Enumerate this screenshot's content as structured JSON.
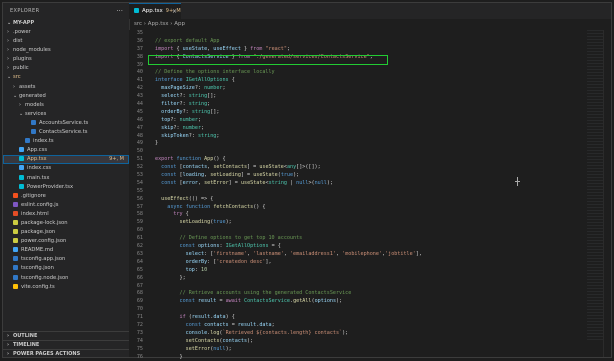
{
  "explorer": {
    "title": "EXPLORER",
    "menu": "···",
    "root": "MY-APP",
    "items": [
      {
        "label": ".power",
        "depth": 0,
        "chev": "›",
        "color": ""
      },
      {
        "label": "dist",
        "depth": 0,
        "chev": "›",
        "color": ""
      },
      {
        "label": "node_modules",
        "depth": 0,
        "chev": "›",
        "color": ""
      },
      {
        "label": "plugins",
        "depth": 0,
        "chev": "›",
        "color": ""
      },
      {
        "label": "public",
        "depth": 0,
        "chev": "›",
        "color": ""
      },
      {
        "label": "src",
        "depth": 0,
        "chev": "⌄",
        "color": "#e2c08d"
      },
      {
        "label": "assets",
        "depth": 1,
        "chev": "›",
        "color": ""
      },
      {
        "label": "generated",
        "depth": 1,
        "chev": "⌄",
        "color": ""
      },
      {
        "label": "models",
        "depth": 2,
        "chev": "›",
        "color": ""
      },
      {
        "label": "services",
        "depth": 2,
        "chev": "⌄",
        "color": ""
      },
      {
        "label": "AccountsService.ts",
        "depth": 3,
        "chev": "",
        "icon": "#3178c6",
        "color": ""
      },
      {
        "label": "ContactsService.ts",
        "depth": 3,
        "chev": "",
        "icon": "#3178c6",
        "color": ""
      },
      {
        "label": "index.ts",
        "depth": 2,
        "chev": "",
        "icon": "#3178c6",
        "color": ""
      },
      {
        "label": "App.css",
        "depth": 1,
        "chev": "",
        "icon": "#42a5f5",
        "color": ""
      },
      {
        "label": "App.tsx",
        "depth": 1,
        "chev": "",
        "icon": "#00bcd4",
        "color": "#e2c08d",
        "active": true,
        "badge": "9+, M"
      },
      {
        "label": "index.css",
        "depth": 1,
        "chev": "",
        "icon": "#42a5f5",
        "color": ""
      },
      {
        "label": "main.tsx",
        "depth": 1,
        "chev": "",
        "icon": "#00bcd4",
        "color": ""
      },
      {
        "label": "PowerProvider.tsx",
        "depth": 1,
        "chev": "",
        "icon": "#00bcd4",
        "color": ""
      },
      {
        "label": ".gitignore",
        "depth": 0,
        "chev": "",
        "icon": "#f4511e",
        "color": ""
      },
      {
        "label": "eslint.config.js",
        "depth": 0,
        "chev": "",
        "icon": "#7e57c2",
        "color": ""
      },
      {
        "label": "index.html",
        "depth": 0,
        "chev": "",
        "icon": "#e44d26",
        "color": ""
      },
      {
        "label": "package-lock.json",
        "depth": 0,
        "chev": "",
        "icon": "#cbcb41",
        "color": ""
      },
      {
        "label": "package.json",
        "depth": 0,
        "chev": "",
        "icon": "#cbcb41",
        "color": ""
      },
      {
        "label": "power.config.json",
        "depth": 0,
        "chev": "",
        "icon": "#cbcb41",
        "color": ""
      },
      {
        "label": "README.md",
        "depth": 0,
        "chev": "",
        "icon": "#42a5f5",
        "color": ""
      },
      {
        "label": "tsconfig.app.json",
        "depth": 0,
        "chev": "",
        "icon": "#3178c6",
        "color": ""
      },
      {
        "label": "tsconfig.json",
        "depth": 0,
        "chev": "",
        "icon": "#3178c6",
        "color": ""
      },
      {
        "label": "tsconfig.node.json",
        "depth": 0,
        "chev": "",
        "icon": "#3178c6",
        "color": ""
      },
      {
        "label": "vite.config.ts",
        "depth": 0,
        "chev": "",
        "icon": "#ffc107",
        "color": ""
      }
    ],
    "outline": "OUTLINE",
    "timeline": "TIMELINE",
    "power_pages": "POWER PAGES ACTIONS"
  },
  "tab": {
    "label": "App.tsx",
    "badge": "9+, M",
    "close": "×"
  },
  "breadcrumb": "src  ›  App.tsx  ›  App",
  "colors": {
    "keyword": "#c586c0",
    "storage": "#569cd6",
    "func": "#dcdcaa",
    "type": "#4ec9b0",
    "var": "#9cdcfe",
    "string": "#ce9178",
    "number": "#b5cea8",
    "comment": "#6a9955",
    "plain": "#d4d4d4",
    "highlight": "#22cc33"
  },
  "code": [
    {
      "n": "35",
      "t": []
    },
    {
      "n": "36",
      "t": [
        [
          "comment",
          "// export default App"
        ]
      ]
    },
    {
      "n": "37",
      "t": [
        [
          "keyword",
          "import"
        ],
        [
          "plain",
          " { "
        ],
        [
          "var",
          "useState"
        ],
        [
          "plain",
          ", "
        ],
        [
          "var",
          "useEffect"
        ],
        [
          "plain",
          " } "
        ],
        [
          "keyword",
          "from"
        ],
        [
          "plain",
          " "
        ],
        [
          "string",
          "\"react\""
        ],
        [
          "plain",
          ";"
        ]
      ]
    },
    {
      "n": "38",
      "t": [
        [
          "keyword",
          "import"
        ],
        [
          "plain",
          " { "
        ],
        [
          "var",
          "ContactsService"
        ],
        [
          "plain",
          " } "
        ],
        [
          "keyword",
          "from"
        ],
        [
          "plain",
          " "
        ],
        [
          "string",
          "\"./generated/services/ContactsService\""
        ],
        [
          "plain",
          ";"
        ]
      ]
    },
    {
      "n": "39",
      "t": []
    },
    {
      "n": "40",
      "t": [
        [
          "comment",
          "// Define the options interface locally"
        ]
      ]
    },
    {
      "n": "41",
      "t": [
        [
          "storage",
          "interface"
        ],
        [
          "plain",
          " "
        ],
        [
          "type",
          "IGetAllOptions"
        ],
        [
          "plain",
          " {"
        ]
      ]
    },
    {
      "n": "42",
      "t": [
        [
          "plain",
          "  "
        ],
        [
          "var",
          "maxPageSize"
        ],
        [
          "plain",
          "?: "
        ],
        [
          "type",
          "number"
        ],
        [
          "plain",
          ";"
        ]
      ]
    },
    {
      "n": "43",
      "t": [
        [
          "plain",
          "  "
        ],
        [
          "var",
          "select"
        ],
        [
          "plain",
          "?: "
        ],
        [
          "type",
          "string"
        ],
        [
          "plain",
          "[];"
        ]
      ]
    },
    {
      "n": "44",
      "t": [
        [
          "plain",
          "  "
        ],
        [
          "var",
          "filter"
        ],
        [
          "plain",
          "?: "
        ],
        [
          "type",
          "string"
        ],
        [
          "plain",
          ";"
        ]
      ]
    },
    {
      "n": "45",
      "t": [
        [
          "plain",
          "  "
        ],
        [
          "var",
          "orderBy"
        ],
        [
          "plain",
          "?: "
        ],
        [
          "type",
          "string"
        ],
        [
          "plain",
          "[];"
        ]
      ]
    },
    {
      "n": "46",
      "t": [
        [
          "plain",
          "  "
        ],
        [
          "var",
          "top"
        ],
        [
          "plain",
          "?: "
        ],
        [
          "type",
          "number"
        ],
        [
          "plain",
          ";"
        ]
      ]
    },
    {
      "n": "47",
      "t": [
        [
          "plain",
          "  "
        ],
        [
          "var",
          "skip"
        ],
        [
          "plain",
          "?: "
        ],
        [
          "type",
          "number"
        ],
        [
          "plain",
          ";"
        ]
      ]
    },
    {
      "n": "48",
      "t": [
        [
          "plain",
          "  "
        ],
        [
          "var",
          "skipToken"
        ],
        [
          "plain",
          "?: "
        ],
        [
          "type",
          "string"
        ],
        [
          "plain",
          ";"
        ]
      ]
    },
    {
      "n": "49",
      "t": [
        [
          "plain",
          "}"
        ]
      ]
    },
    {
      "n": "50",
      "t": []
    },
    {
      "n": "51",
      "t": [
        [
          "keyword",
          "export"
        ],
        [
          "plain",
          " "
        ],
        [
          "storage",
          "function"
        ],
        [
          "plain",
          " "
        ],
        [
          "func",
          "App"
        ],
        [
          "plain",
          "() {"
        ]
      ]
    },
    {
      "n": "52",
      "t": [
        [
          "plain",
          "  "
        ],
        [
          "storage",
          "const"
        ],
        [
          "plain",
          " ["
        ],
        [
          "var",
          "contacts"
        ],
        [
          "plain",
          ", "
        ],
        [
          "func",
          "setContacts"
        ],
        [
          "plain",
          "] = "
        ],
        [
          "func",
          "useState"
        ],
        [
          "plain",
          "<"
        ],
        [
          "type",
          "any"
        ],
        [
          "plain",
          "[]>([]);"
        ]
      ]
    },
    {
      "n": "53",
      "t": [
        [
          "plain",
          "  "
        ],
        [
          "storage",
          "const"
        ],
        [
          "plain",
          " ["
        ],
        [
          "var",
          "loading"
        ],
        [
          "plain",
          ", "
        ],
        [
          "func",
          "setLoading"
        ],
        [
          "plain",
          "] = "
        ],
        [
          "func",
          "useState"
        ],
        [
          "plain",
          "("
        ],
        [
          "storage",
          "true"
        ],
        [
          "plain",
          ");"
        ]
      ]
    },
    {
      "n": "54",
      "t": [
        [
          "plain",
          "  "
        ],
        [
          "storage",
          "const"
        ],
        [
          "plain",
          " ["
        ],
        [
          "var",
          "error"
        ],
        [
          "plain",
          ", "
        ],
        [
          "func",
          "setError"
        ],
        [
          "plain",
          "] = "
        ],
        [
          "func",
          "useState"
        ],
        [
          "plain",
          "<"
        ],
        [
          "type",
          "string"
        ],
        [
          "plain",
          " | "
        ],
        [
          "storage",
          "null"
        ],
        [
          "plain",
          ">("
        ],
        [
          "storage",
          "null"
        ],
        [
          "plain",
          ");"
        ]
      ]
    },
    {
      "n": "55",
      "t": []
    },
    {
      "n": "56",
      "t": [
        [
          "plain",
          "  "
        ],
        [
          "func",
          "useEffect"
        ],
        [
          "plain",
          "(() => {"
        ]
      ]
    },
    {
      "n": "57",
      "t": [
        [
          "plain",
          "    "
        ],
        [
          "storage",
          "async"
        ],
        [
          "plain",
          " "
        ],
        [
          "storage",
          "function"
        ],
        [
          "plain",
          " "
        ],
        [
          "func",
          "fetchContacts"
        ],
        [
          "plain",
          "() {"
        ]
      ]
    },
    {
      "n": "58",
      "t": [
        [
          "plain",
          "      "
        ],
        [
          "keyword",
          "try"
        ],
        [
          "plain",
          " {"
        ]
      ]
    },
    {
      "n": "59",
      "t": [
        [
          "plain",
          "        "
        ],
        [
          "func",
          "setLoading"
        ],
        [
          "plain",
          "("
        ],
        [
          "storage",
          "true"
        ],
        [
          "plain",
          ");"
        ]
      ]
    },
    {
      "n": "60",
      "t": []
    },
    {
      "n": "61",
      "t": [
        [
          "plain",
          "        "
        ],
        [
          "comment",
          "// Define options to get top 10 accounts"
        ]
      ]
    },
    {
      "n": "62",
      "t": [
        [
          "plain",
          "        "
        ],
        [
          "storage",
          "const"
        ],
        [
          "plain",
          " "
        ],
        [
          "var",
          "options"
        ],
        [
          "plain",
          ": "
        ],
        [
          "type",
          "IGetAllOptions"
        ],
        [
          "plain",
          " = {"
        ]
      ]
    },
    {
      "n": "63",
      "t": [
        [
          "plain",
          "          "
        ],
        [
          "var",
          "select"
        ],
        [
          "plain",
          ": ["
        ],
        [
          "string",
          "'firstname'"
        ],
        [
          "plain",
          ", "
        ],
        [
          "string",
          "'lastname'"
        ],
        [
          "plain",
          ", "
        ],
        [
          "string",
          "'emailaddress1'"
        ],
        [
          "plain",
          ", "
        ],
        [
          "string",
          "'mobilephone'"
        ],
        [
          "plain",
          ","
        ],
        [
          "string",
          "'jobtitle'"
        ],
        [
          "plain",
          "],"
        ]
      ]
    },
    {
      "n": "64",
      "t": [
        [
          "plain",
          "          "
        ],
        [
          "var",
          "orderBy"
        ],
        [
          "plain",
          ": ["
        ],
        [
          "string",
          "'createdon desc'"
        ],
        [
          "plain",
          "],"
        ]
      ]
    },
    {
      "n": "65",
      "t": [
        [
          "plain",
          "          "
        ],
        [
          "var",
          "top"
        ],
        [
          "plain",
          ": "
        ],
        [
          "number",
          "10"
        ]
      ]
    },
    {
      "n": "66",
      "t": [
        [
          "plain",
          "        };"
        ]
      ]
    },
    {
      "n": "67",
      "t": []
    },
    {
      "n": "68",
      "t": [
        [
          "plain",
          "        "
        ],
        [
          "comment",
          "// Retrieve accounts using the generated ContactsService"
        ]
      ]
    },
    {
      "n": "69",
      "t": [
        [
          "plain",
          "        "
        ],
        [
          "storage",
          "const"
        ],
        [
          "plain",
          " "
        ],
        [
          "var",
          "result"
        ],
        [
          "plain",
          " = "
        ],
        [
          "keyword",
          "await"
        ],
        [
          "plain",
          " "
        ],
        [
          "type",
          "ContactsService"
        ],
        [
          "plain",
          "."
        ],
        [
          "func",
          "getAll"
        ],
        [
          "plain",
          "("
        ],
        [
          "var",
          "options"
        ],
        [
          "plain",
          ");"
        ]
      ]
    },
    {
      "n": "70",
      "t": []
    },
    {
      "n": "71",
      "t": [
        [
          "plain",
          "        "
        ],
        [
          "keyword",
          "if"
        ],
        [
          "plain",
          " ("
        ],
        [
          "var",
          "result"
        ],
        [
          "plain",
          "."
        ],
        [
          "var",
          "data"
        ],
        [
          "plain",
          ") {"
        ]
      ]
    },
    {
      "n": "72",
      "t": [
        [
          "plain",
          "          "
        ],
        [
          "storage",
          "const"
        ],
        [
          "plain",
          " "
        ],
        [
          "var",
          "contacts"
        ],
        [
          "plain",
          " = "
        ],
        [
          "var",
          "result"
        ],
        [
          "plain",
          "."
        ],
        [
          "var",
          "data"
        ],
        [
          "plain",
          ";"
        ]
      ]
    },
    {
      "n": "73",
      "t": [
        [
          "plain",
          "          "
        ],
        [
          "var",
          "console"
        ],
        [
          "plain",
          "."
        ],
        [
          "func",
          "log"
        ],
        [
          "plain",
          "("
        ],
        [
          "string",
          "`Retrieved ${contacts.length} contacts`"
        ],
        [
          "plain",
          ");"
        ]
      ]
    },
    {
      "n": "74",
      "t": [
        [
          "plain",
          "          "
        ],
        [
          "func",
          "setContacts"
        ],
        [
          "plain",
          "("
        ],
        [
          "var",
          "contacts"
        ],
        [
          "plain",
          ");"
        ]
      ]
    },
    {
      "n": "75",
      "t": [
        [
          "plain",
          "          "
        ],
        [
          "func",
          "setError"
        ],
        [
          "plain",
          "("
        ],
        [
          "storage",
          "null"
        ],
        [
          "plain",
          ");"
        ]
      ]
    },
    {
      "n": "76",
      "t": [
        [
          "plain",
          "        }"
        ]
      ]
    }
  ]
}
